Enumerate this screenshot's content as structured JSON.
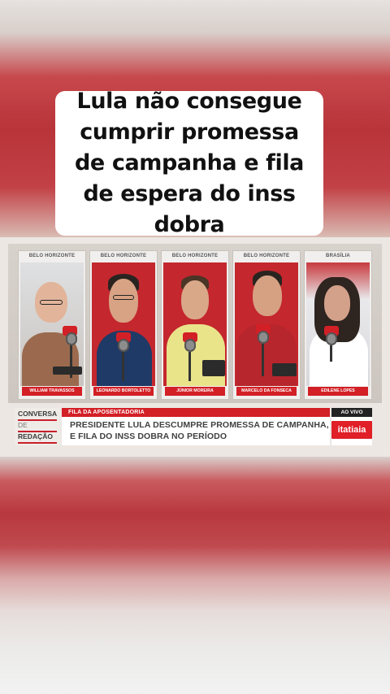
{
  "caption": {
    "text": "Lula não consegue cumprir promessa de campanha e fila de espera do inss dobra"
  },
  "panels": [
    {
      "location": "BELO HORIZONTE",
      "name": "WILLIAM TRAVASSOS"
    },
    {
      "location": "BELO HORIZONTE",
      "name": "LEONARDO BORTOLETTO"
    },
    {
      "location": "BELO HORIZONTE",
      "name": "JÚNIOR MOREIRA"
    },
    {
      "location": "BELO HORIZONTE",
      "name": "MARCELO DA FONSECA"
    },
    {
      "location": "BRASÍLIA",
      "name": "EDILENE LOPES"
    }
  ],
  "lower_third": {
    "program_line1": "CONVERSA",
    "program_line2": "DE",
    "program_line3": "REDAÇÃO",
    "tag": "FILA DA APOSENTADORIA",
    "headline_line1": "PRESIDENTE LULA DESCUMPRE PROMESSA DE CAMPANHA,",
    "headline_line2": "E FILA DO INSS DOBRA NO PERÍODO",
    "live_label": "AO VIVO",
    "logo_text": "itatiaia"
  },
  "colors": {
    "brand_red": "#d31f26",
    "caption_bg": "#ffffff",
    "live_bg": "#222222"
  },
  "icons": [
    "microphone-icon"
  ]
}
